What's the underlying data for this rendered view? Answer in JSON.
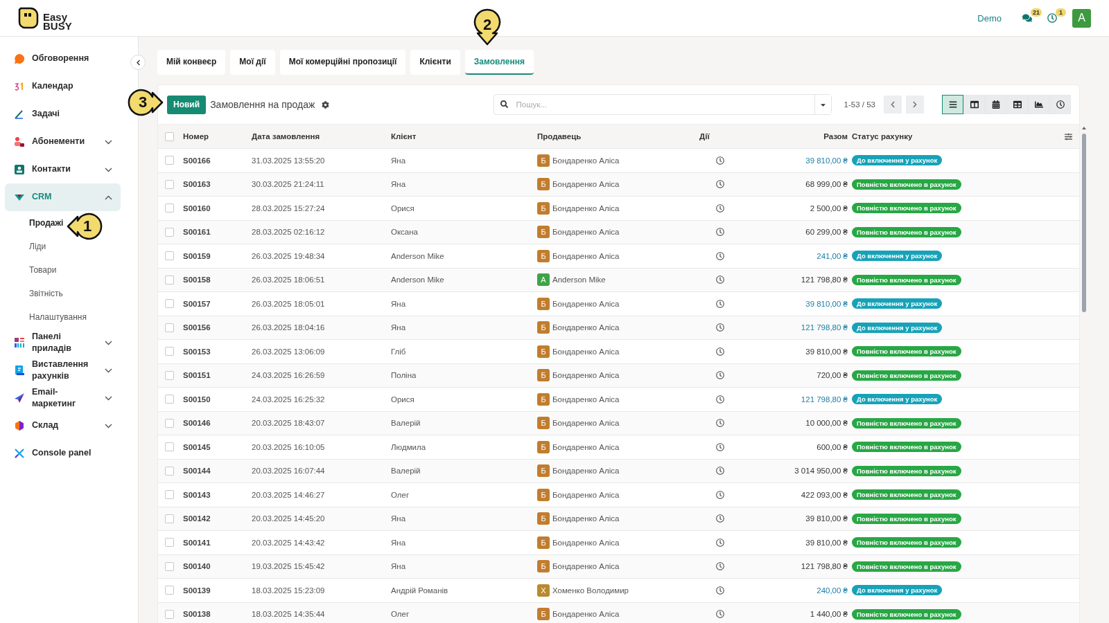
{
  "logo": {
    "line1": "Easy",
    "line2": "BUSY"
  },
  "topbar": {
    "user": "Demo",
    "messages_badge": "21",
    "activities_badge": "1",
    "avatar": "A"
  },
  "sidebar": {
    "items": [
      {
        "kind": "discuss",
        "label": "Обговорення",
        "selected": false
      },
      {
        "kind": "calendar",
        "label": "Календар",
        "selected": false
      },
      {
        "kind": "tasks",
        "label": "Задачі",
        "selected": false
      },
      {
        "kind": "subscriptions",
        "label": "Абонементи",
        "expanded": false,
        "selected": false
      },
      {
        "kind": "contacts",
        "label": "Контакти",
        "expanded": false,
        "selected": false
      },
      {
        "kind": "crm",
        "label": "CRM",
        "expanded": true,
        "selected": true,
        "children": [
          {
            "label": "Продажі",
            "selected": true
          },
          {
            "label": "Ліди",
            "selected": false
          },
          {
            "label": "Товари",
            "selected": false
          },
          {
            "label": "Звітність",
            "selected": false
          },
          {
            "label": "Налаштування",
            "selected": false
          }
        ]
      },
      {
        "kind": "dashboards",
        "label": "Панелі приладів",
        "expanded": false,
        "selected": false
      },
      {
        "kind": "invoicing",
        "label": "Виставлення рахунків",
        "expanded": false,
        "selected": false
      },
      {
        "kind": "email",
        "label": "Email-маркетинг",
        "expanded": false,
        "selected": false
      },
      {
        "kind": "inventory",
        "label": "Склад",
        "expanded": false,
        "selected": false
      },
      {
        "kind": "console",
        "label": "Console panel",
        "selected": false
      }
    ]
  },
  "tabs": [
    {
      "label": "Мій конвеєр",
      "selected": false
    },
    {
      "label": "Мої дії",
      "selected": false
    },
    {
      "label": "Мої комерційні пропозиції",
      "selected": false
    },
    {
      "label": "Клієнти",
      "selected": false
    },
    {
      "label": "Замовлення",
      "selected": true
    }
  ],
  "toolbar": {
    "new_button": "Новий",
    "title": "Замовлення на продаж",
    "search": {
      "placeholder": "Пошук..."
    },
    "pager": "1-53 / 53",
    "views": [
      {
        "kind": "list",
        "selected": true
      },
      {
        "kind": "kanban",
        "selected": false
      },
      {
        "kind": "calendar",
        "selected": false
      },
      {
        "kind": "pivot",
        "selected": false
      },
      {
        "kind": "graph",
        "selected": false
      },
      {
        "kind": "activity",
        "selected": false
      }
    ]
  },
  "table": {
    "select_all_checked": false,
    "columns": [
      "Номер",
      "Дата замовлення",
      "Клієнт",
      "Продавець",
      "Дії",
      "Разом",
      "Статус рахунку"
    ],
    "rows": [
      {
        "number": "S00166",
        "date": "31.03.2025 13:55:20",
        "client": "Яна",
        "seller_initial": "Б",
        "seller": "Бондаренко Аліса",
        "color": "#c17d2e",
        "total": "39 810,00 ₴",
        "kind": "to_invoice",
        "status": "До включення у рахунок",
        "checked": false
      },
      {
        "number": "S00163",
        "date": "30.03.2025 21:24:11",
        "client": "Яна",
        "seller_initial": "Б",
        "seller": "Бондаренко Аліса",
        "color": "#c17d2e",
        "total": "68 999,00 ₴",
        "kind": "invoiced",
        "status": "Повністю включено в рахунок",
        "checked": false
      },
      {
        "number": "S00160",
        "date": "28.03.2025 15:27:24",
        "client": "Орися",
        "seller_initial": "Б",
        "seller": "Бондаренко Аліса",
        "color": "#c17d2e",
        "total": "2 500,00 ₴",
        "kind": "invoiced",
        "status": "Повністю включено в рахунок",
        "checked": false
      },
      {
        "number": "S00161",
        "date": "28.03.2025 02:16:12",
        "client": "Оксана",
        "seller_initial": "Б",
        "seller": "Бондаренко Аліса",
        "color": "#c17d2e",
        "total": "60 299,00 ₴",
        "kind": "invoiced",
        "status": "Повністю включено в рахунок",
        "checked": false
      },
      {
        "number": "S00159",
        "date": "26.03.2025 19:48:34",
        "client": "Anderson Mike",
        "seller_initial": "Б",
        "seller": "Бондаренко Аліса",
        "color": "#c17d2e",
        "total": "241,00 ₴",
        "kind": "to_invoice",
        "status": "До включення у рахунок",
        "checked": false
      },
      {
        "number": "S00158",
        "date": "26.03.2025 18:06:51",
        "client": "Anderson Mike",
        "seller_initial": "A",
        "seller": "Anderson Mike",
        "color": "#3da447",
        "total": "121 798,80 ₴",
        "kind": "invoiced",
        "status": "Повністю включено в рахунок",
        "checked": false
      },
      {
        "number": "S00157",
        "date": "26.03.2025 18:05:01",
        "client": "Яна",
        "seller_initial": "Б",
        "seller": "Бондаренко Аліса",
        "color": "#c17d2e",
        "total": "39 810,00 ₴",
        "kind": "to_invoice",
        "status": "До включення у рахунок",
        "checked": false
      },
      {
        "number": "S00156",
        "date": "26.03.2025 18:04:16",
        "client": "Яна",
        "seller_initial": "Б",
        "seller": "Бондаренко Аліса",
        "color": "#c17d2e",
        "total": "121 798,80 ₴",
        "kind": "to_invoice",
        "status": "До включення у рахунок",
        "checked": false
      },
      {
        "number": "S00153",
        "date": "26.03.2025 13:06:09",
        "client": "Гліб",
        "seller_initial": "Б",
        "seller": "Бондаренко Аліса",
        "color": "#c17d2e",
        "total": "39 810,00 ₴",
        "kind": "invoiced",
        "status": "Повністю включено в рахунок",
        "checked": false
      },
      {
        "number": "S00151",
        "date": "24.03.2025 16:26:59",
        "client": "Поліна",
        "seller_initial": "Б",
        "seller": "Бондаренко Аліса",
        "color": "#c17d2e",
        "total": "720,00 ₴",
        "kind": "invoiced",
        "status": "Повністю включено в рахунок",
        "checked": false
      },
      {
        "number": "S00150",
        "date": "24.03.2025 16:25:32",
        "client": "Орися",
        "seller_initial": "Б",
        "seller": "Бондаренко Аліса",
        "color": "#c17d2e",
        "total": "121 798,80 ₴",
        "kind": "to_invoice",
        "status": "До включення у рахунок",
        "checked": false
      },
      {
        "number": "S00146",
        "date": "20.03.2025 18:43:07",
        "client": "Валерій",
        "seller_initial": "Б",
        "seller": "Бондаренко Аліса",
        "color": "#c17d2e",
        "total": "10 000,00 ₴",
        "kind": "invoiced",
        "status": "Повністю включено в рахунок",
        "checked": false
      },
      {
        "number": "S00145",
        "date": "20.03.2025 16:10:05",
        "client": "Людмила",
        "seller_initial": "Б",
        "seller": "Бондаренко Аліса",
        "color": "#c17d2e",
        "total": "600,00 ₴",
        "kind": "invoiced",
        "status": "Повністю включено в рахунок",
        "checked": false
      },
      {
        "number": "S00144",
        "date": "20.03.2025 16:07:44",
        "client": "Валерій",
        "seller_initial": "Б",
        "seller": "Бондаренко Аліса",
        "color": "#c17d2e",
        "total": "3 014 950,00 ₴",
        "kind": "invoiced",
        "status": "Повністю включено в рахунок",
        "checked": false
      },
      {
        "number": "S00143",
        "date": "20.03.2025 14:46:27",
        "client": "Олег",
        "seller_initial": "Б",
        "seller": "Бондаренко Аліса",
        "color": "#c17d2e",
        "total": "422 093,00 ₴",
        "kind": "invoiced",
        "status": "Повністю включено в рахунок",
        "checked": false
      },
      {
        "number": "S00142",
        "date": "20.03.2025 14:45:20",
        "client": "Яна",
        "seller_initial": "Б",
        "seller": "Бондаренко Аліса",
        "color": "#c17d2e",
        "total": "39 810,00 ₴",
        "kind": "invoiced",
        "status": "Повністю включено в рахунок",
        "checked": false
      },
      {
        "number": "S00141",
        "date": "20.03.2025 14:43:42",
        "client": "Яна",
        "seller_initial": "Б",
        "seller": "Бондаренко Аліса",
        "color": "#c17d2e",
        "total": "39 810,00 ₴",
        "kind": "invoiced",
        "status": "Повністю включено в рахунок",
        "checked": false
      },
      {
        "number": "S00140",
        "date": "19.03.2025 15:45:42",
        "client": "Яна",
        "seller_initial": "Б",
        "seller": "Бондаренко Аліса",
        "color": "#c17d2e",
        "total": "121 798,80 ₴",
        "kind": "invoiced",
        "status": "Повністю включено в рахунок",
        "checked": false
      },
      {
        "number": "S00139",
        "date": "18.03.2025 15:23:09",
        "client": "Андрій Романів",
        "seller_initial": "Х",
        "seller": "Хоменко Володимир",
        "color": "#b98a2f",
        "total": "240,00 ₴",
        "kind": "to_invoice",
        "status": "До включення у рахунок",
        "checked": false
      },
      {
        "number": "S00138",
        "date": "18.03.2025 14:35:44",
        "client": "Олег",
        "seller_initial": "Б",
        "seller": "Бондаренко Аліса",
        "color": "#c17d2e",
        "total": "1 440,00 ₴",
        "kind": "invoiced",
        "status": "Повністю включено в рахунок",
        "checked": false
      }
    ]
  },
  "step_markers": [
    {
      "kind": "left",
      "label": "1"
    },
    {
      "kind": "down",
      "label": "2"
    },
    {
      "kind": "right",
      "label": "3"
    }
  ]
}
